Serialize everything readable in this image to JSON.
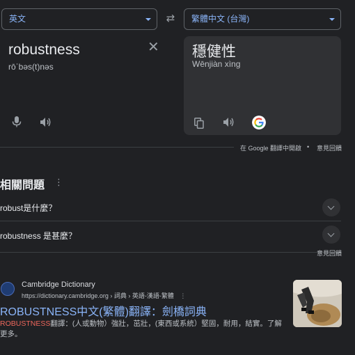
{
  "source_lang": "英文",
  "target_lang": "繁體中文 (台灣)",
  "source": {
    "text": "robustness",
    "phonetic": "rōˈbəs(t)nəs"
  },
  "target": {
    "text": "穩健性",
    "romanization": "Wēnjiàn xìng"
  },
  "footer": {
    "open_in_translate": "在 Google 翻譯中開啟",
    "dot": "•",
    "feedback": "意見回饋"
  },
  "related": {
    "title": "相關問題",
    "questions": [
      "robust是什麼？",
      "robustness 是甚麼？"
    ],
    "feedback": "意見回饋"
  },
  "result": {
    "site": "Cambridge Dictionary",
    "url": "https://dictionary.cambridge.org › 詞典 › 英語-漢語-繁體",
    "title": "ROBUSTNESS中文(繁體)翻譯：劍橋詞典",
    "snippet_highlight": "ROBUSTNESS",
    "snippet_rest": "翻譯：(人或動物）強壯，茁壯，(東西或系統）堅固，耐用，結實。了解更多。"
  },
  "colors": {
    "accent": "#8ab4f8",
    "background": "#202124",
    "panel": "#303134",
    "highlight": "#ee675c"
  }
}
